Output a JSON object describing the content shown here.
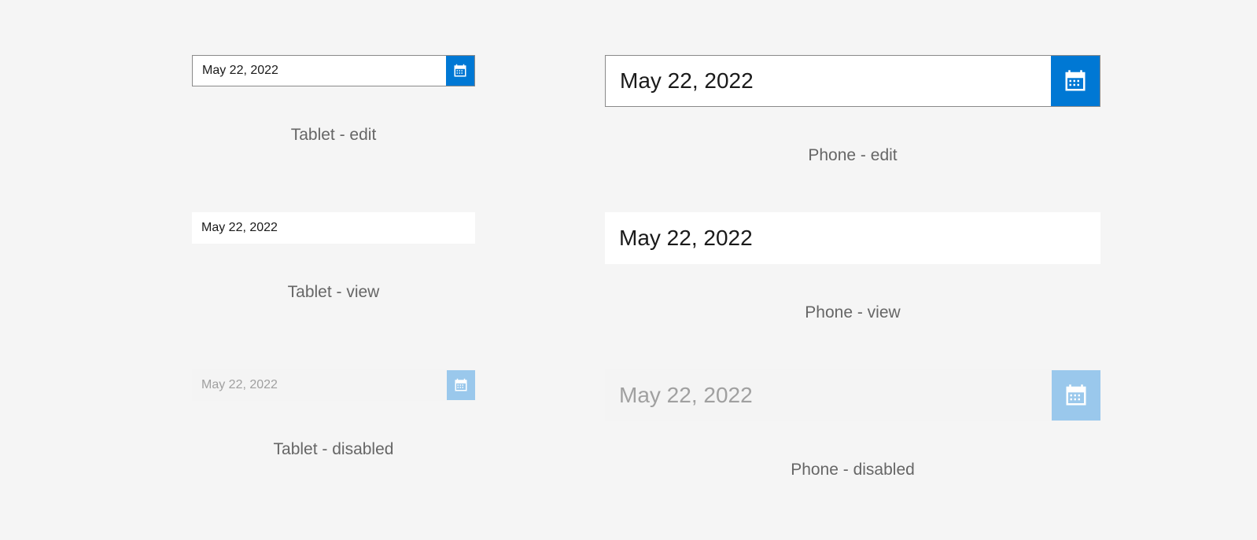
{
  "controls": {
    "tablet_edit": {
      "value": "May 22, 2022",
      "caption": "Tablet - edit"
    },
    "phone_edit": {
      "value": "May 22, 2022",
      "caption": "Phone - edit"
    },
    "tablet_view": {
      "value": "May 22, 2022",
      "caption": "Tablet - view"
    },
    "phone_view": {
      "value": "May 22, 2022",
      "caption": "Phone - view"
    },
    "tablet_disabled": {
      "value": "May 22, 2022",
      "caption": "Tablet - disabled"
    },
    "phone_disabled": {
      "value": "May 22, 2022",
      "caption": "Phone - disabled"
    }
  }
}
